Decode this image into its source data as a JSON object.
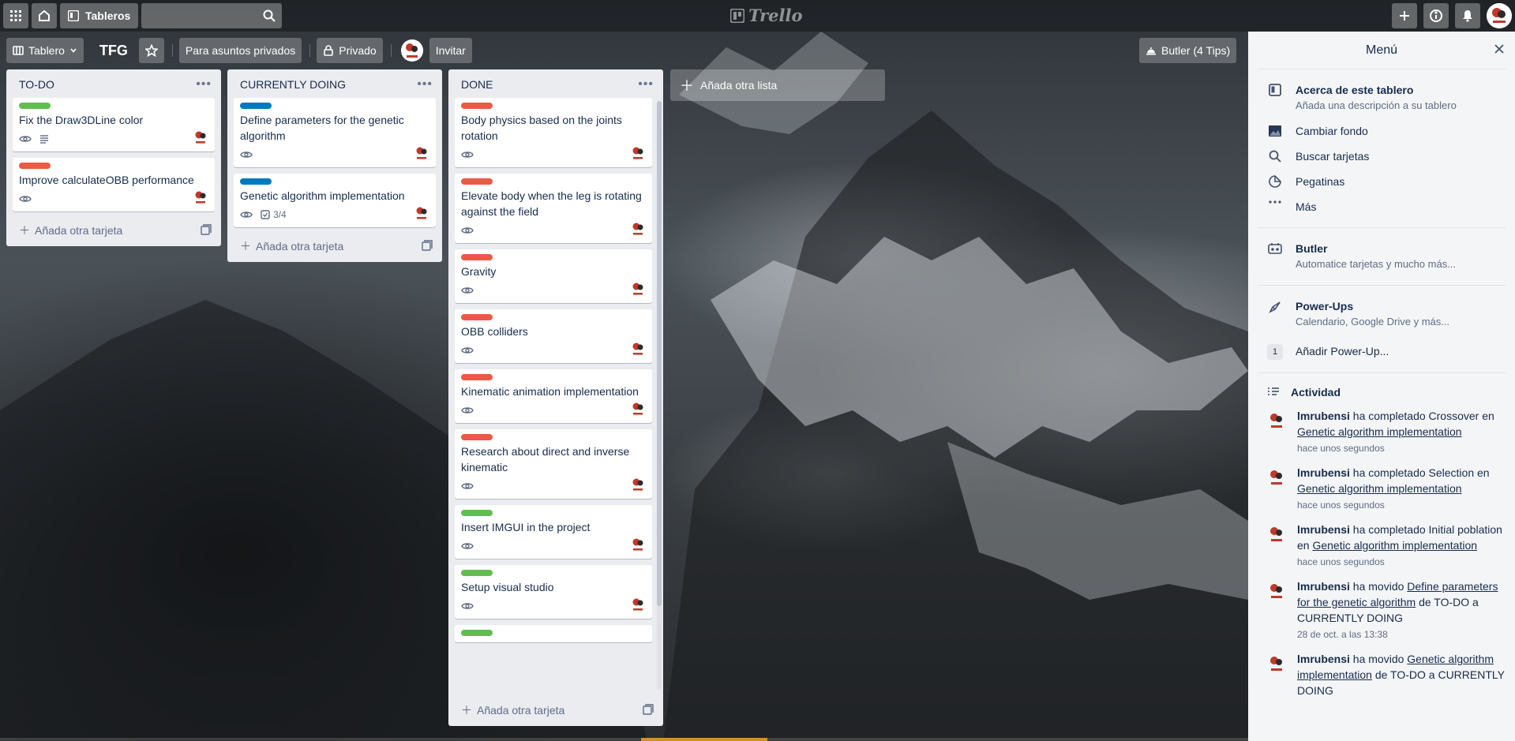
{
  "header": {
    "boards_label": "Tableros",
    "search_placeholder": "",
    "logo_text": "Trello"
  },
  "board": {
    "view_label": "Tablero",
    "title": "TFG",
    "team_label": "Para asuntos privados",
    "visibility_label": "Privado",
    "invite_label": "Invitar",
    "butler_label": "Butler (4 Tips)"
  },
  "lists": [
    {
      "title": "TO-DO",
      "add_label": "Añada otra tarjeta",
      "cards": [
        {
          "label_color": "#61bd4f",
          "title": "Fix the Draw3DLine color",
          "has_watch": true,
          "has_description": true
        },
        {
          "label_color": "#eb5a46",
          "title": "Improve calculateOBB performance",
          "has_watch": true
        }
      ]
    },
    {
      "title": "CURRENTLY DOING",
      "add_label": "Añada otra tarjeta",
      "cards": [
        {
          "label_color": "#0079bf",
          "title": "Define parameters for the genetic algorithm",
          "has_watch": true
        },
        {
          "label_color": "#0079bf",
          "title": "Genetic algorithm implementation",
          "has_watch": true,
          "checklist": "3/4"
        }
      ]
    },
    {
      "title": "DONE",
      "add_label": "Añada otra tarjeta",
      "cards": [
        {
          "label_color": "#eb5a46",
          "title": "Body physics based on the joints rotation",
          "has_watch": true
        },
        {
          "label_color": "#eb5a46",
          "title": "Elevate body when the leg is rotating against the field",
          "has_watch": true
        },
        {
          "label_color": "#eb5a46",
          "title": "Gravity",
          "has_watch": true
        },
        {
          "label_color": "#eb5a46",
          "title": "OBB colliders",
          "has_watch": true
        },
        {
          "label_color": "#eb5a46",
          "title": "Kinematic animation implementation",
          "has_watch": true
        },
        {
          "label_color": "#eb5a46",
          "title": "Research about direct and inverse kinematic",
          "has_watch": true
        },
        {
          "label_color": "#61bd4f",
          "title": "Insert IMGUI in the project",
          "has_watch": true
        },
        {
          "label_color": "#61bd4f",
          "title": "Setup visual studio",
          "has_watch": true
        },
        {
          "label_color": "#61bd4f",
          "title": "",
          "has_watch": false
        }
      ]
    }
  ],
  "add_list_label": "Añada otra lista",
  "menu": {
    "title": "Menú",
    "items": [
      {
        "icon": "board-icon",
        "title": "Acerca de este tablero",
        "subtitle": "Añada una descripción a su tablero"
      },
      {
        "icon": "image-icon",
        "title": "Cambiar fondo",
        "subtitle": ""
      },
      {
        "icon": "search-icon",
        "title": "Buscar tarjetas",
        "subtitle": ""
      },
      {
        "icon": "sticker-icon",
        "title": "Pegatinas",
        "subtitle": ""
      },
      {
        "icon": "more-icon",
        "title": "Más",
        "subtitle": ""
      }
    ],
    "butler": {
      "title": "Butler",
      "subtitle": "Automatice tarjetas y mucho más..."
    },
    "powerups": {
      "title": "Power-Ups",
      "subtitle": "Calendario, Google Drive y más...",
      "count": "1",
      "add_label": "Añadir Power-Up..."
    },
    "activity_title": "Actividad",
    "activity": [
      {
        "user": "lmrubensi",
        "pre": " ha completado Crossover en ",
        "link": "Genetic algorithm implementation",
        "post": "",
        "time": "hace unos segundos"
      },
      {
        "user": "lmrubensi",
        "pre": " ha completado Selection en ",
        "link": "Genetic algorithm implementation",
        "post": "",
        "time": "hace unos segundos"
      },
      {
        "user": "lmrubensi",
        "pre": " ha completado Initial poblation en ",
        "link": "Genetic algorithm implementation",
        "post": "",
        "time": "hace unos segundos"
      },
      {
        "user": "lmrubensi",
        "pre": " ha movido ",
        "link": "Define parameters for the genetic algorithm",
        "post": " de TO-DO a CURRENTLY DOING",
        "time": "28 de oct. a las 13:38"
      },
      {
        "user": "lmrubensi",
        "pre": " ha movido ",
        "link": "Genetic algorithm implementation",
        "post": " de TO-DO a CURRENTLY DOING",
        "time": ""
      }
    ]
  }
}
